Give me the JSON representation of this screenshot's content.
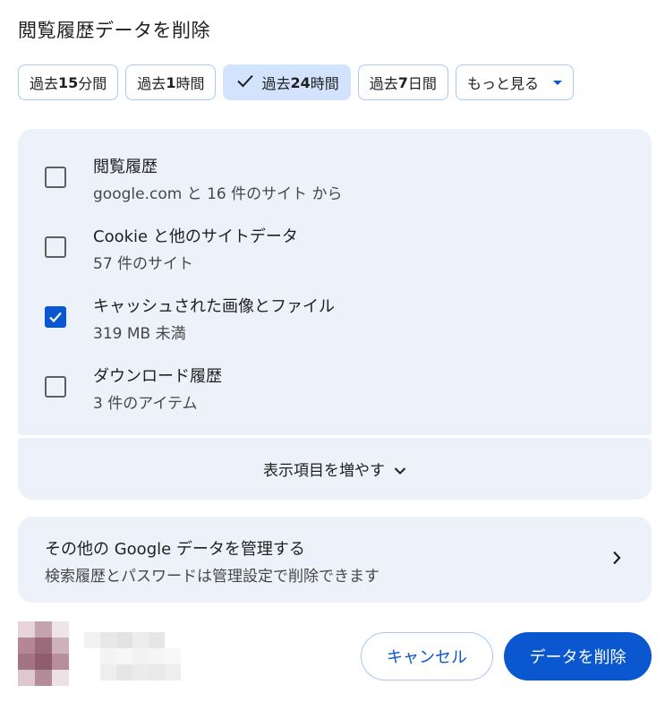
{
  "dialog": {
    "title": "閲覧履歴データを削除"
  },
  "time_ranges": [
    {
      "prefix": "過去 ",
      "bold": "15",
      "suffix": " 分間",
      "selected": false
    },
    {
      "prefix": "過去 ",
      "bold": "1",
      "suffix": " 時間",
      "selected": false
    },
    {
      "prefix": "過去 ",
      "bold": "24",
      "suffix": " 時間",
      "selected": true
    },
    {
      "prefix": "過去 ",
      "bold": "7",
      "suffix": " 日間",
      "selected": false
    }
  ],
  "more_range_label": "もっと見る",
  "options": [
    {
      "title": "閲覧履歴",
      "subtitle": "google.com と 16 件のサイト から",
      "checked": false
    },
    {
      "title": "Cookie と他のサイトデータ",
      "subtitle": "57 件のサイト",
      "checked": false
    },
    {
      "title": "キャッシュされた画像とファイル",
      "subtitle": "319 MB 未満",
      "checked": true
    },
    {
      "title": "ダウンロード履歴",
      "subtitle": "3 件のアイテム",
      "checked": false
    }
  ],
  "show_more_label": "表示項目を増やす",
  "manage": {
    "title": "その他の Google データを管理する",
    "subtitle": "検索履歴とパスワードは管理設定で削除できます"
  },
  "buttons": {
    "cancel": "キャンセル",
    "delete": "データを削除"
  },
  "colors": {
    "accent": "#0b57d0",
    "chip_border": "#a8c7fa",
    "chip_selected_bg": "#d3e3fd",
    "panel_bg": "#edf2fa"
  },
  "icons": {
    "selected_chip": "check-icon",
    "dropdown": "caret-down-icon",
    "show_more": "chevron-down-icon",
    "manage": "chevron-right-icon"
  }
}
